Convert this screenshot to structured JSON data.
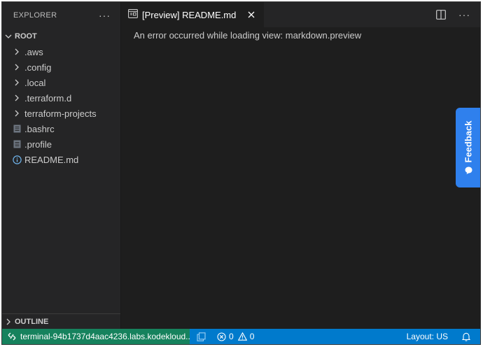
{
  "sidebar": {
    "title": "EXPLORER",
    "root_label": "ROOT",
    "items": [
      {
        "label": ".aws",
        "type": "folder",
        "icon": "chevron-right-icon"
      },
      {
        "label": ".config",
        "type": "folder",
        "icon": "chevron-right-icon"
      },
      {
        "label": ".local",
        "type": "folder",
        "icon": "chevron-right-icon"
      },
      {
        "label": ".terraform.d",
        "type": "folder",
        "icon": "chevron-right-icon"
      },
      {
        "label": "terraform-projects",
        "type": "folder",
        "icon": "chevron-right-icon"
      },
      {
        "label": ".bashrc",
        "type": "file",
        "icon": "text-file-icon"
      },
      {
        "label": ".profile",
        "type": "file",
        "icon": "text-file-icon"
      },
      {
        "label": "README.md",
        "type": "file",
        "icon": "info-icon"
      }
    ],
    "outline_label": "OUTLINE"
  },
  "editor": {
    "tab_label": "[Preview] README.md",
    "message": "An error occurred while loading view: markdown.preview"
  },
  "feedback_label": "Feedback",
  "statusbar": {
    "remote": "terminal-94b1737d4aac4236.labs.kodekloud...",
    "errors": "0",
    "warnings": "0",
    "layout": "Layout: US"
  },
  "colors": {
    "statusbar": "#007acc",
    "remote": "#16825d",
    "feedback": "#2f80ed"
  }
}
